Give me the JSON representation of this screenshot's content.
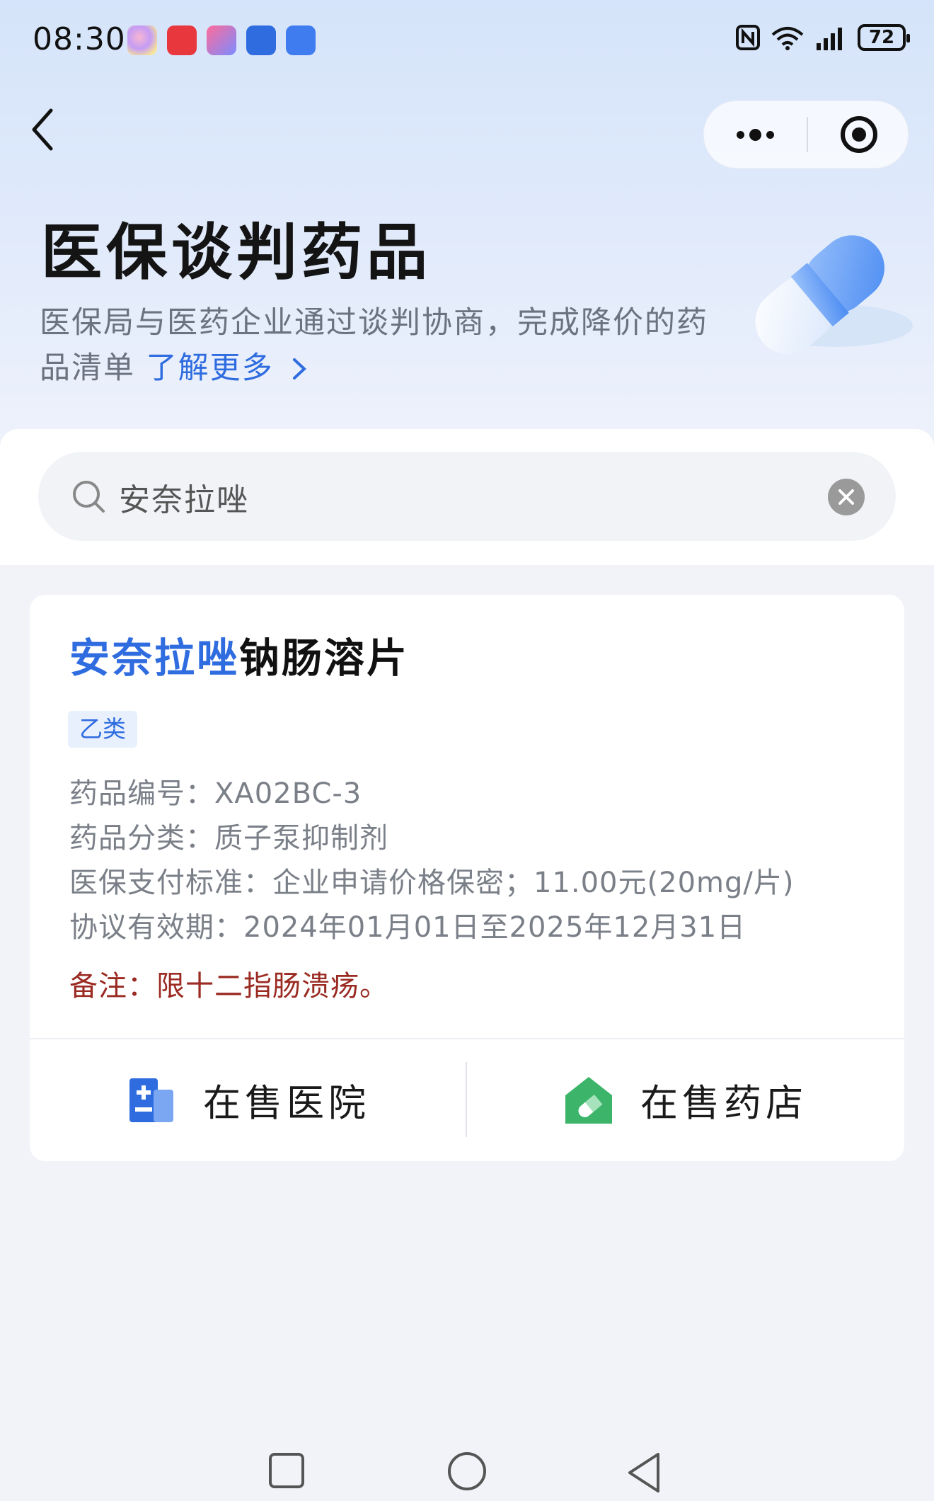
{
  "status_bar": {
    "time": "08:30",
    "app_icons": [
      "browser-icon",
      "app-gallery-icon",
      "info-app-icon",
      "search-app-icon",
      "upload-app-icon"
    ],
    "battery": "72",
    "indicators": [
      "nfc-icon",
      "wifi-6-icon",
      "signal-icon"
    ]
  },
  "nav": {
    "back": "back-icon",
    "more": "more-icon",
    "close": "target-icon"
  },
  "header": {
    "title": "医保谈判药品",
    "description": "医保局与医药企业通过谈判协商，完成降价的药品清单",
    "learn_more": "了解更多",
    "illustration": "pill-capsule-illustration"
  },
  "search": {
    "value": "安奈拉唑",
    "placeholder": ""
  },
  "result": {
    "name_highlight": "安奈拉唑",
    "name_rest": "钠肠溶片",
    "tag": "乙类",
    "fields": [
      "药品编号：XA02BC-3",
      "药品分类：质子泵抑制剂",
      "医保支付标准：企业申请价格保密；11.00元(20mg/片)",
      "协议有效期：2024年01月01日至2025年12月31日"
    ],
    "note": "备注：限十二指肠溃疡。",
    "actions": {
      "hospital": "在售医院",
      "pharmacy": "在售药店"
    }
  },
  "colors": {
    "accent": "#2f6ce0",
    "note": "#9a2a22",
    "hospital_icon": "#2f6ce0",
    "pharmacy_icon": "#3cb56a"
  }
}
